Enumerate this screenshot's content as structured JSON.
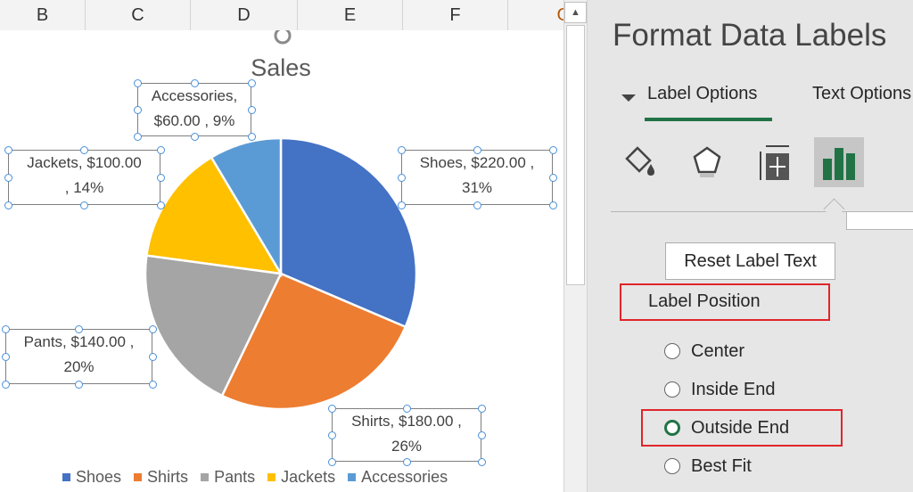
{
  "columns": [
    "B",
    "C",
    "D",
    "E",
    "F",
    "G"
  ],
  "chart": {
    "title": "Sales",
    "labels": {
      "accessories": [
        "Accessories,",
        "$60.00 , 9%"
      ],
      "jackets": [
        "Jackets,  $100.00",
        ", 14%"
      ],
      "shoes": [
        "Shoes,  $220.00 ,",
        "31%"
      ],
      "pants": [
        "Pants,  $140.00 ,",
        "20%"
      ],
      "shirts": [
        "Shirts,  $180.00 ,",
        "26%"
      ]
    }
  },
  "chart_data": {
    "type": "pie",
    "title": "Sales",
    "categories": [
      "Shoes",
      "Shirts",
      "Pants",
      "Jackets",
      "Accessories"
    ],
    "values": [
      220,
      180,
      140,
      100,
      60
    ],
    "percents": [
      31,
      26,
      20,
      14,
      9
    ],
    "colors": [
      "#4472c4",
      "#ed7d31",
      "#a5a5a5",
      "#ffc000",
      "#5b9bd5"
    ],
    "legend_placement": "bottom"
  },
  "pane": {
    "title": "Format Data Labels",
    "tabs": [
      "Label Options",
      "Text Options"
    ],
    "icons": [
      "fill-line-icon",
      "effects-pentagon-icon",
      "size-properties-icon",
      "label-options-bars-icon"
    ],
    "reset_button": "Reset Label Text",
    "label_position_title": "Label Position",
    "positions": [
      "Center",
      "Inside End",
      "Outside End",
      "Best Fit"
    ],
    "selected_position": "Outside End"
  },
  "accent_colors": {
    "excel_green": "#217346",
    "highlight_red": "#e0252b",
    "handle_blue": "#4a90d9"
  }
}
